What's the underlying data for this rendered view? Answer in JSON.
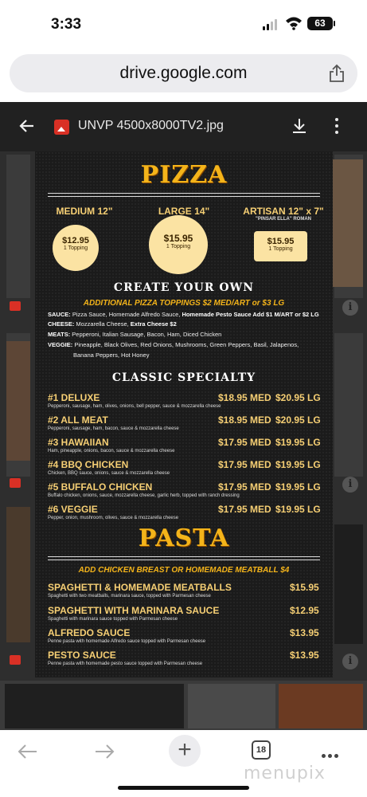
{
  "status": {
    "time": "3:33",
    "battery": "63"
  },
  "browser": {
    "url": "drive.google.com",
    "tabs_count": "18"
  },
  "viewer": {
    "file_name": "UNVP 4500x8000TV2.jpg"
  },
  "menu": {
    "pizza_title": "PIZZA",
    "sizes": [
      {
        "label": "MEDIUM 12\"",
        "sub": "",
        "price": "$12.95",
        "note": "1 Topping"
      },
      {
        "label": "LARGE 14\"",
        "sub": "",
        "price": "$15.95",
        "note": "1 Topping"
      },
      {
        "label": "ARTISAN 12\" x 7\"",
        "sub": "\"PINSAR ELLA\" ROMAN",
        "price": "$15.95",
        "note": "1 Topping"
      }
    ],
    "create_title": "CREATE YOUR OWN",
    "create_sub": "ADDITIONAL PIZZA TOPPINGS $2 MED/ART or $3 LG",
    "toppings": [
      {
        "key": "SAUCE:",
        "text": " Pizza Sauce, Homemade Alfredo Sauce, ",
        "bold": "Homemade Pesto Sauce Add $1 M/ART or $2 LG"
      },
      {
        "key": "CHEESE:",
        "text": " Mozzarella Cheese, ",
        "bold": "Extra Cheese $2"
      },
      {
        "key": "MEATS:",
        "text": " Pepperoni, Italian Sausage, Bacon, Ham, Diced Chicken",
        "bold": ""
      },
      {
        "key": "VEGGIE:",
        "text": " Pineapple, Black Olives, Red Onions, Mushrooms, Green Peppers, Basil, Jalapenos,",
        "bold": ""
      },
      {
        "key": "",
        "text": "Banana Peppers, Hot Honey",
        "bold": ""
      }
    ],
    "classic_title": "CLASSIC SPECIALTY",
    "specialties": [
      {
        "name": "#1 DELUXE",
        "desc": "Pepperoni, sausage, ham, olives, onions, bell pepper, sauce & mozzarella cheese",
        "med": "$18.95 MED",
        "lg": "$20.95 LG"
      },
      {
        "name": "#2 ALL MEAT",
        "desc": "Pepperoni, sausage, ham, bacon, sauce & mozzarella cheese",
        "med": "$18.95 MED",
        "lg": "$20.95 LG"
      },
      {
        "name": "#3 HAWAIIAN",
        "desc": "Ham, pineapple, onions, bacon, sauce & mozzarella cheese",
        "med": "$17.95 MED",
        "lg": "$19.95 LG"
      },
      {
        "name": "#4 BBQ CHICKEN",
        "desc": "Chicken, BBQ sauce, onions, sauce & mozzarella cheese",
        "med": "$17.95 MED",
        "lg": "$19.95 LG"
      },
      {
        "name": "#5 BUFFALO CHICKEN",
        "desc": "Buffalo chicken, onions, sauce, mozzarella cheese, garlic herb, topped with ranch dressing",
        "med": "$17.95 MED",
        "lg": "$19.95 LG"
      },
      {
        "name": "#6 VEGGIE",
        "desc": "Pepper, onion, mushroom, olives, sauce & mozzarella cheese",
        "med": "$17.95 MED",
        "lg": "$19.95 LG"
      }
    ],
    "pasta_title": "PASTA",
    "pasta_sub": "ADD CHICKEN BREAST OR HOMEMADE MEATBALL $4",
    "pastas": [
      {
        "name": "SPAGHETTI & HOMEMADE MEATBALLS",
        "desc": "Spaghetti with two meatballs, marinara sauce, topped with Parmesan cheese",
        "price": "$15.95"
      },
      {
        "name": "SPAGHETTI WITH MARINARA SAUCE",
        "desc": "Spaghetti with marinara sauce topped with Parmesan cheese",
        "price": "$12.95"
      },
      {
        "name": "ALFREDO SAUCE",
        "desc": "Penne pasta with homemade Alfredo sauce topped with Parmesan cheese",
        "price": "$13.95"
      },
      {
        "name": "PESTO SAUCE",
        "desc": "Penne pasta with homemade pesto sauce topped with Parmesan cheese",
        "price": "$13.95"
      }
    ]
  },
  "watermark": "menupix",
  "colors": {
    "accent": "#f4b41a",
    "price_fill": "#fbe3a3",
    "menu_bg": "#1b1b1b"
  }
}
